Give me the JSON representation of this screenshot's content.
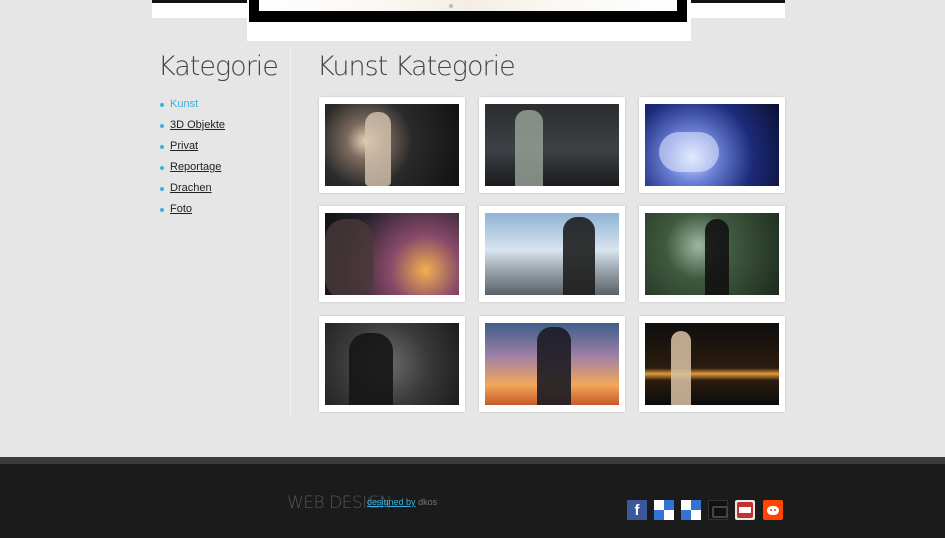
{
  "sidebar": {
    "title": "Kategorie",
    "items": [
      {
        "label": "Kunst",
        "active": true
      },
      {
        "label": "3D Objekte",
        "active": false
      },
      {
        "label": "Privat",
        "active": false
      },
      {
        "label": "Reportage",
        "active": false
      },
      {
        "label": "Drachen",
        "active": false
      },
      {
        "label": "Foto",
        "active": false
      }
    ]
  },
  "main": {
    "title": "Kunst Kategorie",
    "gallery_count_rows": 3,
    "gallery_count_cols": 3
  },
  "footer": {
    "brand": "WEB DESIGN",
    "credit_link": "designed by",
    "credit_author": "dkos",
    "social_icons": [
      "facebook-icon",
      "delicious-icon",
      "delicious-icon",
      "digg-icon",
      "youtube-icon",
      "reddit-icon"
    ]
  },
  "colors": {
    "accent": "#3ab0e2",
    "background": "#e6e6e6",
    "footer": "#1b1b1b"
  }
}
